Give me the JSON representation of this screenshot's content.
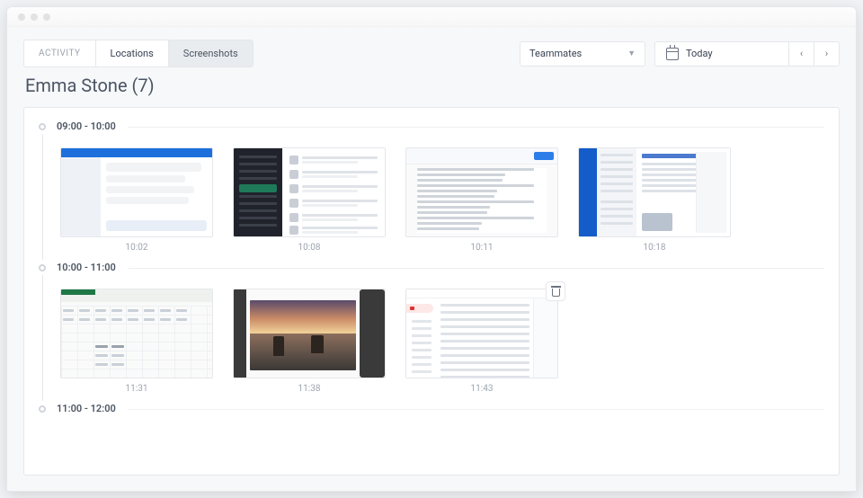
{
  "tabs": {
    "activity": "ACTIVITY",
    "locations": "Locations",
    "screenshots": "Screenshots"
  },
  "teammates": {
    "label": "Teammates"
  },
  "date": {
    "label": "Today"
  },
  "title": "Emma Stone (7)",
  "slots": [
    {
      "range": "09:00 - 10:00",
      "shots": [
        {
          "time": "10:02",
          "kind": "chat-app"
        },
        {
          "time": "10:08",
          "kind": "dark-chat"
        },
        {
          "time": "10:11",
          "kind": "document"
        },
        {
          "time": "10:18",
          "kind": "mail"
        }
      ]
    },
    {
      "range": "10:00 - 11:00",
      "shots": [
        {
          "time": "11:31",
          "kind": "spreadsheet"
        },
        {
          "time": "11:38",
          "kind": "photo-editor"
        },
        {
          "time": "11:43",
          "kind": "webmail",
          "delete_badge": true
        }
      ]
    },
    {
      "range": "11:00 - 12:00",
      "shots": []
    }
  ]
}
